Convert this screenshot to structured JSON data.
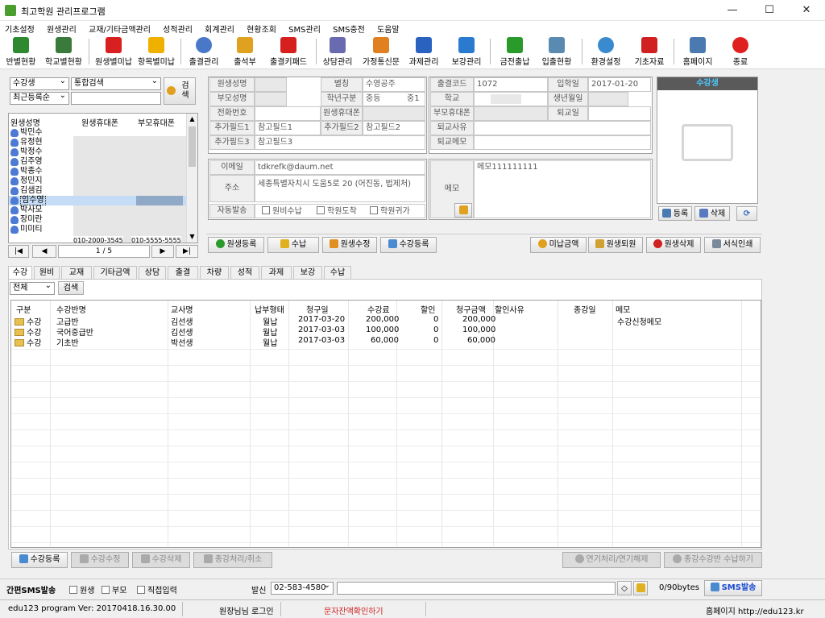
{
  "window": {
    "title": "최고학원 관리프로그램",
    "minimize": "—",
    "maximize": "☐",
    "close": "✕"
  },
  "menu": [
    "기초설정",
    "원생관리",
    "교재/기타금액관리",
    "성적관리",
    "회계관리",
    "현황조회",
    "SMS관리",
    "SMS충전",
    "도움말"
  ],
  "toolbar": [
    {
      "label": "반별현황",
      "color": "#2f8a2f"
    },
    {
      "label": "학교별현황",
      "color": "#3a7a3a"
    },
    {
      "label": "원생별미납",
      "color": "#d92020"
    },
    {
      "label": "항목별미납",
      "color": "#f0b000"
    },
    {
      "label": "출결관리",
      "color": "#4a78c8"
    },
    {
      "label": "출석부",
      "color": "#e0a020"
    },
    {
      "label": "출결키패드",
      "color": "#d62020"
    },
    {
      "label": "상담관리",
      "color": "#6a6ab0"
    },
    {
      "label": "가정통신문",
      "color": "#e08020"
    },
    {
      "label": "과제관리",
      "color": "#2a62c0"
    },
    {
      "label": "보강관리",
      "color": "#2a7ad0"
    },
    {
      "label": "금전출납",
      "color": "#2a9a2a"
    },
    {
      "label": "입출현황",
      "color": "#5a8ab0"
    },
    {
      "label": "환경설정",
      "color": "#3a8ad0"
    },
    {
      "label": "기초자료",
      "color": "#d02020"
    },
    {
      "label": "홈페이지",
      "color": "#4a7ab0"
    },
    {
      "label": "종료",
      "color": "#e02020"
    }
  ],
  "search": {
    "type_value": "수강생",
    "mode_value": "통합검색",
    "sort_value": "최근등록순",
    "query": "",
    "button": "검\n색"
  },
  "student_list": {
    "headers": [
      "원생성명",
      "원생휴대폰",
      "부모휴대폰"
    ],
    "names": [
      "박민수",
      "유정현",
      "박정수",
      "김주영",
      "박종수",
      "정민지",
      "김샘김",
      "임수영",
      "박사모",
      "장미란",
      "미미티"
    ],
    "selected_index": 7,
    "partial_phone_1": "010-2000-3545",
    "partial_phone_2": "010-5555-5555"
  },
  "pager": {
    "first": "|◀",
    "prev": "◀",
    "page": "1 / 5",
    "next": "▶",
    "last": "▶|"
  },
  "info": {
    "labels": {
      "name": "원생성명",
      "nickname": "별칭",
      "code": "출결코드",
      "enroll": "입학일",
      "parent": "부모성명",
      "grade": "학년구분",
      "school": "학교",
      "birthday": "생년월일",
      "phone": "전화번호",
      "mobile": "원생휴대폰",
      "parent_mobile": "부모휴대폰",
      "leave": "퇴교일",
      "extra1": "추가필드1",
      "extra2": "추가필드2",
      "leave_reason": "퇴교사유",
      "extra3": "추가필드3",
      "leave_memo": "퇴교메모",
      "email": "이메일",
      "address": "주소",
      "auto_send": "자동발송",
      "memo": "메모"
    },
    "values": {
      "nickname": "수영공주",
      "code": "1072",
      "enroll": "2017-01-20",
      "grade": "중등",
      "grade_year": "중1",
      "extra1": "참고필드1",
      "extra2": "참고필드2",
      "extra3": "참고필드3",
      "email": "tdkrefk@daum.net",
      "address": "세종특별자치시 도움5로 20 (어진동, 법제처)",
      "memo": "메모111111111"
    },
    "auto_send_options": [
      "원비수납",
      "학원도착",
      "학원귀가"
    ]
  },
  "photo": {
    "title": "수강생",
    "register": "등록",
    "delete": "삭제"
  },
  "actions": [
    "원생등록",
    "수납",
    "원생수정",
    "수강등록",
    "미납금액",
    "원생퇴원",
    "원생삭제",
    "서식인쇄"
  ],
  "tabs": [
    "수강",
    "원비",
    "교재",
    "기타금액",
    "상담",
    "출결",
    "차량",
    "성적",
    "과제",
    "보강",
    "수납"
  ],
  "filter": {
    "value": "전체",
    "button": "검색"
  },
  "grid": {
    "headers": [
      "구분",
      "수강반명",
      "교사명",
      "납부형태",
      "청구일",
      "수강료",
      "할인",
      "청구금액",
      "할인사유",
      "종강일",
      "메모"
    ],
    "rows": [
      [
        "수강",
        "고급반",
        "김선생",
        "월납",
        "2017-03-20",
        "200,000",
        "0",
        "200,000",
        "",
        "",
        "수강신청메모"
      ],
      [
        "수강",
        "국어중급반",
        "김선생",
        "월납",
        "2017-03-03",
        "100,000",
        "0",
        "100,000",
        "",
        "",
        " "
      ],
      [
        "수강",
        "기초반",
        "박선생",
        "월납",
        "2017-03-03",
        "60,000",
        "0",
        "60,000",
        "",
        "",
        " "
      ]
    ]
  },
  "bottom_buttons": [
    "수강등록",
    "수강수정",
    "수강삭제",
    "종강처리/취소",
    "연기처리/연기해제",
    "종강수강반 수납하기"
  ],
  "sms": {
    "title": "간편SMS발송",
    "targets": [
      "원생",
      "부모",
      "직접입력"
    ],
    "sender_label": "발신",
    "sender": "02-583-4580",
    "bytes": "0/90bytes",
    "send": "SMS발송"
  },
  "status": {
    "version": "edu123 program Ver: 20170418.16.30.00",
    "login": "원장님님 로그인",
    "balance": "문자잔액확인하기",
    "homepage": "홈페이지 http://edu123.kr"
  }
}
